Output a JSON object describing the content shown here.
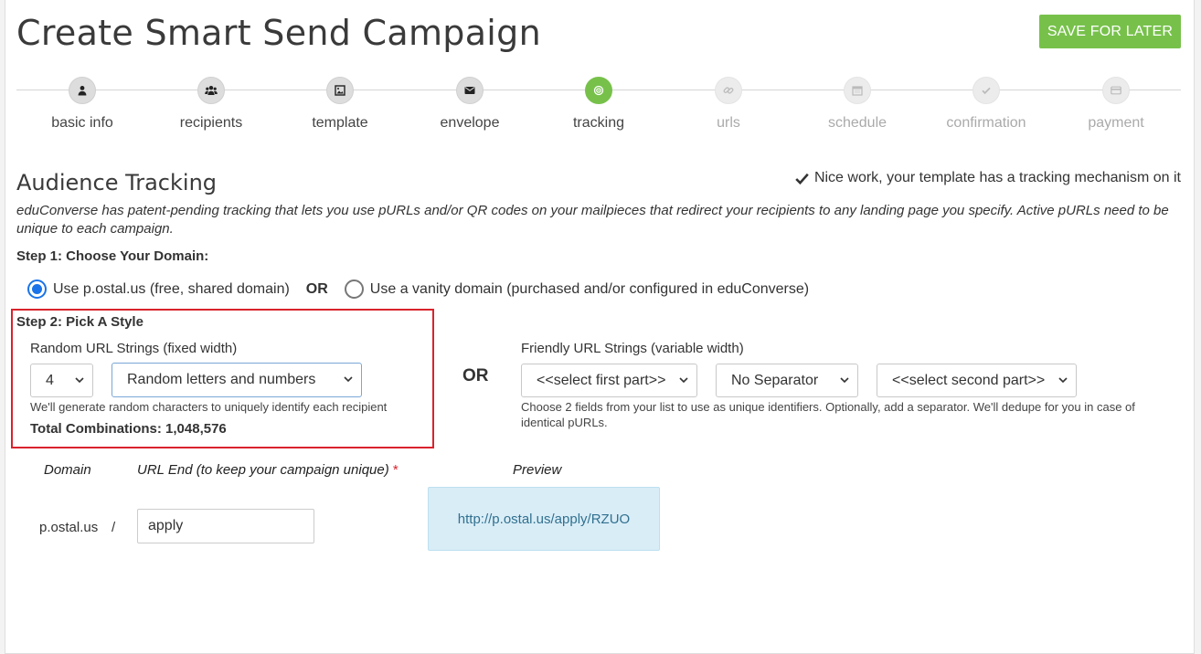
{
  "header": {
    "title": "Create Smart Send Campaign",
    "save_label": "SAVE FOR LATER"
  },
  "colors": {
    "accent": "#77c14b",
    "highlight": "#d9232d",
    "radio": "#1a73e8",
    "preview_bg": "#d9edf7"
  },
  "steps": [
    {
      "label": "basic info",
      "icon": "user-icon",
      "state": "done"
    },
    {
      "label": "recipients",
      "icon": "users-icon",
      "state": "done"
    },
    {
      "label": "template",
      "icon": "image-icon",
      "state": "done"
    },
    {
      "label": "envelope",
      "icon": "envelope-icon",
      "state": "done"
    },
    {
      "label": "tracking",
      "icon": "target-icon",
      "state": "active"
    },
    {
      "label": "urls",
      "icon": "link-icon",
      "state": "disabled"
    },
    {
      "label": "schedule",
      "icon": "calendar-icon",
      "state": "disabled"
    },
    {
      "label": "confirmation",
      "icon": "check-icon",
      "state": "disabled"
    },
    {
      "label": "payment",
      "icon": "credit-card-icon",
      "state": "disabled"
    }
  ],
  "tracking": {
    "title": "Audience Tracking",
    "nice_work": "Nice work, your template has a tracking mechanism on it",
    "intro": "eduConverse has patent-pending tracking that lets you use pURLs and/or QR codes on your mailpieces that redirect your recipients to any landing page you specify. Active pURLs need to be unique to each campaign."
  },
  "step1": {
    "title": "Step 1: Choose Your Domain:",
    "option_shared": "Use p.ostal.us (free, shared domain)",
    "or": "OR",
    "option_vanity": "Use a vanity domain (purchased and/or configured in eduConverse)",
    "selected": "shared"
  },
  "step2": {
    "title": "Step 2: Pick A Style",
    "random": {
      "label": "Random URL Strings (fixed width)",
      "length_value": "4",
      "charset_value": "Random letters and numbers",
      "hint": "We'll generate random characters to uniquely identify each recipient",
      "total": "Total Combinations: 1,048,576"
    },
    "or": "OR",
    "friendly": {
      "label": "Friendly URL Strings (variable width)",
      "first_part": "<<select first part>>",
      "separator": "No Separator",
      "second_part": "<<select second part>>",
      "hint": "Choose 2 fields from your list to use as unique identifiers. Optionally, add a separator. We'll dedupe for you in case of identical pURLs."
    }
  },
  "url_config": {
    "domain_header": "Domain",
    "url_end_header": "URL End (to keep your campaign unique)",
    "required_mark": "*",
    "preview_header": "Preview",
    "domain_value": "p.ostal.us",
    "slash": "/",
    "url_end_value": "apply",
    "preview_url": "http://p.ostal.us/apply/RZUO"
  }
}
